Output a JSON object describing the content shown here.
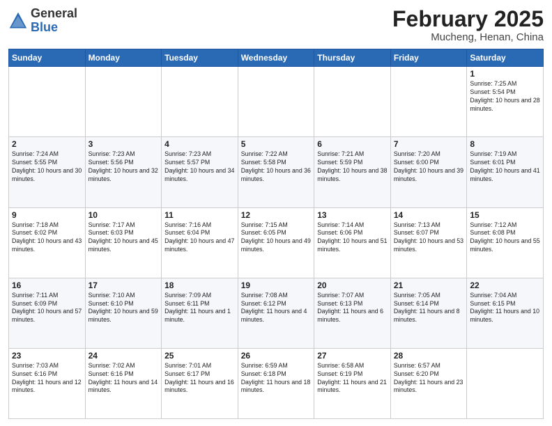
{
  "header": {
    "logo_general": "General",
    "logo_blue": "Blue",
    "month_year": "February 2025",
    "location": "Mucheng, Henan, China"
  },
  "days_of_week": [
    "Sunday",
    "Monday",
    "Tuesday",
    "Wednesday",
    "Thursday",
    "Friday",
    "Saturday"
  ],
  "weeks": [
    [
      {
        "day": "",
        "info": ""
      },
      {
        "day": "",
        "info": ""
      },
      {
        "day": "",
        "info": ""
      },
      {
        "day": "",
        "info": ""
      },
      {
        "day": "",
        "info": ""
      },
      {
        "day": "",
        "info": ""
      },
      {
        "day": "1",
        "info": "Sunrise: 7:25 AM\nSunset: 5:54 PM\nDaylight: 10 hours and 28 minutes."
      }
    ],
    [
      {
        "day": "2",
        "info": "Sunrise: 7:24 AM\nSunset: 5:55 PM\nDaylight: 10 hours and 30 minutes."
      },
      {
        "day": "3",
        "info": "Sunrise: 7:23 AM\nSunset: 5:56 PM\nDaylight: 10 hours and 32 minutes."
      },
      {
        "day": "4",
        "info": "Sunrise: 7:23 AM\nSunset: 5:57 PM\nDaylight: 10 hours and 34 minutes."
      },
      {
        "day": "5",
        "info": "Sunrise: 7:22 AM\nSunset: 5:58 PM\nDaylight: 10 hours and 36 minutes."
      },
      {
        "day": "6",
        "info": "Sunrise: 7:21 AM\nSunset: 5:59 PM\nDaylight: 10 hours and 38 minutes."
      },
      {
        "day": "7",
        "info": "Sunrise: 7:20 AM\nSunset: 6:00 PM\nDaylight: 10 hours and 39 minutes."
      },
      {
        "day": "8",
        "info": "Sunrise: 7:19 AM\nSunset: 6:01 PM\nDaylight: 10 hours and 41 minutes."
      }
    ],
    [
      {
        "day": "9",
        "info": "Sunrise: 7:18 AM\nSunset: 6:02 PM\nDaylight: 10 hours and 43 minutes."
      },
      {
        "day": "10",
        "info": "Sunrise: 7:17 AM\nSunset: 6:03 PM\nDaylight: 10 hours and 45 minutes."
      },
      {
        "day": "11",
        "info": "Sunrise: 7:16 AM\nSunset: 6:04 PM\nDaylight: 10 hours and 47 minutes."
      },
      {
        "day": "12",
        "info": "Sunrise: 7:15 AM\nSunset: 6:05 PM\nDaylight: 10 hours and 49 minutes."
      },
      {
        "day": "13",
        "info": "Sunrise: 7:14 AM\nSunset: 6:06 PM\nDaylight: 10 hours and 51 minutes."
      },
      {
        "day": "14",
        "info": "Sunrise: 7:13 AM\nSunset: 6:07 PM\nDaylight: 10 hours and 53 minutes."
      },
      {
        "day": "15",
        "info": "Sunrise: 7:12 AM\nSunset: 6:08 PM\nDaylight: 10 hours and 55 minutes."
      }
    ],
    [
      {
        "day": "16",
        "info": "Sunrise: 7:11 AM\nSunset: 6:09 PM\nDaylight: 10 hours and 57 minutes."
      },
      {
        "day": "17",
        "info": "Sunrise: 7:10 AM\nSunset: 6:10 PM\nDaylight: 10 hours and 59 minutes."
      },
      {
        "day": "18",
        "info": "Sunrise: 7:09 AM\nSunset: 6:11 PM\nDaylight: 11 hours and 1 minute."
      },
      {
        "day": "19",
        "info": "Sunrise: 7:08 AM\nSunset: 6:12 PM\nDaylight: 11 hours and 4 minutes."
      },
      {
        "day": "20",
        "info": "Sunrise: 7:07 AM\nSunset: 6:13 PM\nDaylight: 11 hours and 6 minutes."
      },
      {
        "day": "21",
        "info": "Sunrise: 7:05 AM\nSunset: 6:14 PM\nDaylight: 11 hours and 8 minutes."
      },
      {
        "day": "22",
        "info": "Sunrise: 7:04 AM\nSunset: 6:15 PM\nDaylight: 11 hours and 10 minutes."
      }
    ],
    [
      {
        "day": "23",
        "info": "Sunrise: 7:03 AM\nSunset: 6:16 PM\nDaylight: 11 hours and 12 minutes."
      },
      {
        "day": "24",
        "info": "Sunrise: 7:02 AM\nSunset: 6:16 PM\nDaylight: 11 hours and 14 minutes."
      },
      {
        "day": "25",
        "info": "Sunrise: 7:01 AM\nSunset: 6:17 PM\nDaylight: 11 hours and 16 minutes."
      },
      {
        "day": "26",
        "info": "Sunrise: 6:59 AM\nSunset: 6:18 PM\nDaylight: 11 hours and 18 minutes."
      },
      {
        "day": "27",
        "info": "Sunrise: 6:58 AM\nSunset: 6:19 PM\nDaylight: 11 hours and 21 minutes."
      },
      {
        "day": "28",
        "info": "Sunrise: 6:57 AM\nSunset: 6:20 PM\nDaylight: 11 hours and 23 minutes."
      },
      {
        "day": "",
        "info": ""
      }
    ]
  ]
}
